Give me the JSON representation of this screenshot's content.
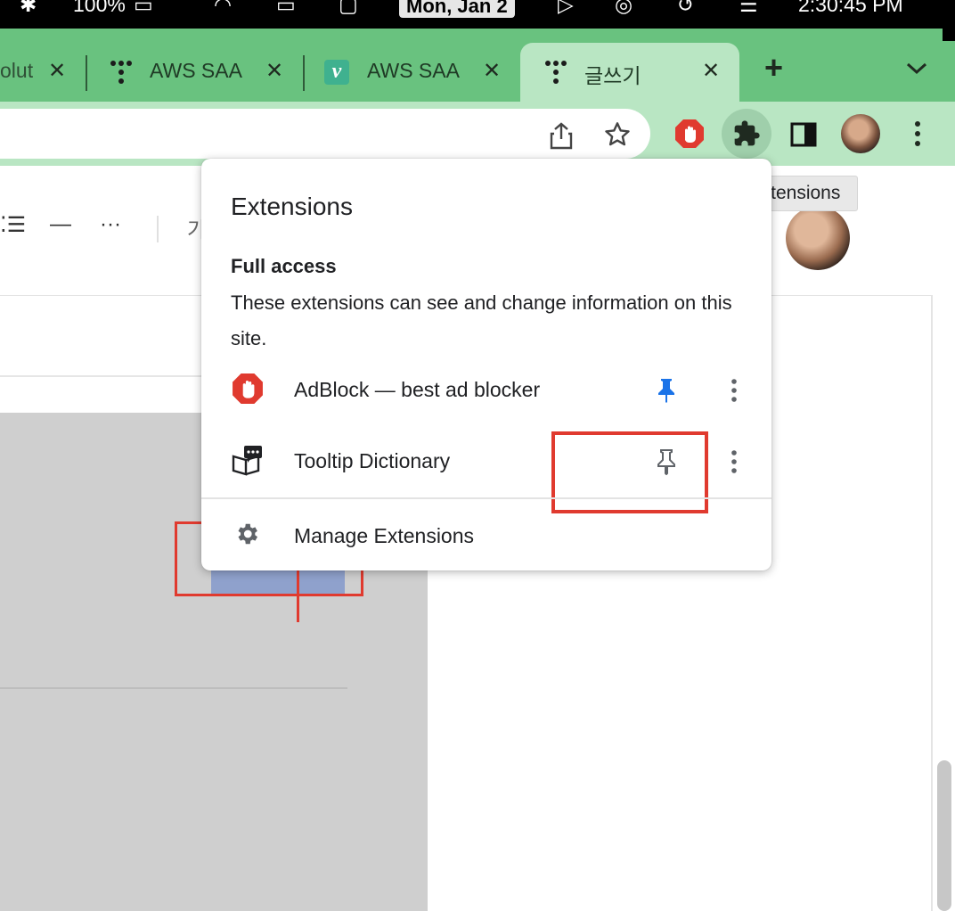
{
  "menubar": {
    "battery": "100%",
    "date": "Mon, Jan 2",
    "time": "2:30:45 PM"
  },
  "tabs": [
    {
      "title": "olut",
      "favicon": "none",
      "active": false
    },
    {
      "title": "AWS SAA",
      "favicon": "dots-logo-icon",
      "active": false
    },
    {
      "title": "AWS SAA",
      "favicon": "v-logo-icon",
      "active": false
    },
    {
      "title": "글쓰기",
      "favicon": "dots-logo-icon",
      "active": true
    }
  ],
  "tab_close_glyph": "✕",
  "new_tab_glyph": "+",
  "page_toolbar": {
    "list_glyph": "⁚☰",
    "dash_glyph": "—",
    "more_glyph": "···",
    "extra": "가"
  },
  "extensions_popup": {
    "title": "Extensions",
    "section_title": "Full access",
    "section_desc": "These extensions can see and change information on this site.",
    "items": [
      {
        "name": "AdBlock — best ad blocker",
        "icon": "adblock-hand-icon",
        "pinned": true
      },
      {
        "name": "Tooltip Dictionary",
        "icon": "book-chat-icon",
        "pinned": false
      }
    ],
    "manage_label": "Manage Extensions"
  },
  "tooltip": "Extensions",
  "colors": {
    "tab_strip": "#69c27f",
    "toolbar": "#b9e6c3",
    "pin_active": "#1a73e8",
    "adblock_red": "#e03a2f",
    "annotation_red": "#e03a2f"
  }
}
